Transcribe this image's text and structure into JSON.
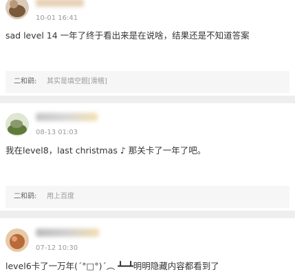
{
  "comments": [
    {
      "timestamp": "10-01 16:41",
      "text": "sad level 14 一年了终于看出来是在说啥，结果还是不知道答案",
      "reply": {
        "author": "二和鹞:",
        "text": "其实是填空题[滑稽]"
      }
    },
    {
      "timestamp": "08-13 01:03",
      "text": "我在level8，last christmas ♪ 那关卡了一年了吧。",
      "reply": {
        "author": "二和鹞:",
        "text": "用上百度"
      }
    },
    {
      "timestamp": "07-12 10:30",
      "text": "level6卡了一万年(ˊ°□°)ˊ︵ ┻━┻明明隐藏内容都看到了"
    }
  ]
}
